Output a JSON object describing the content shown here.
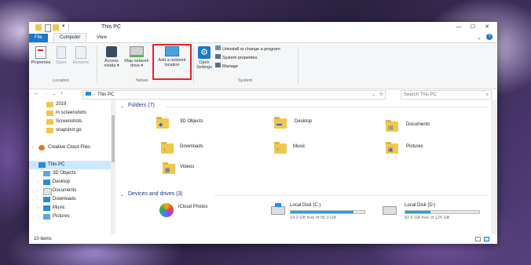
{
  "window": {
    "title": "This PC"
  },
  "ribbon": {
    "tabs": [
      "File",
      "Computer",
      "View"
    ],
    "location_group": {
      "label": "Location",
      "buttons": [
        {
          "label": "Properties"
        },
        {
          "label": "Open"
        },
        {
          "label": "Rename"
        }
      ]
    },
    "network_group": {
      "label": "Netwo",
      "buttons": [
        {
          "label1": "Access",
          "label2": "media ▾"
        },
        {
          "label1": "Map network",
          "label2": "drive ▾"
        },
        {
          "label1": "Add a network",
          "label2": "location"
        }
      ]
    },
    "system_group": {
      "label": "System",
      "open_settings": {
        "label1": "Open",
        "label2": "Settings"
      },
      "links": [
        "Uninstall or change a program",
        "System properties",
        "Manage"
      ]
    }
  },
  "addressbar": {
    "path": "This PC",
    "search_placeholder": "Search This PC"
  },
  "nav": {
    "items": [
      "2019",
      "m screenshots",
      "Screenshots",
      "snapshot go",
      "Creative Cloud Files",
      "This PC",
      "3D Objects",
      "Desktop",
      "Documents",
      "Downloads",
      "Music",
      "Pictures"
    ]
  },
  "content": {
    "folders_header": "Folders (7)",
    "folders": [
      "3D Objects",
      "Desktop",
      "Documents",
      "Downloads",
      "Music",
      "Pictures",
      "Videos"
    ],
    "devices_header": "Devices and drives (3)",
    "devices": [
      {
        "name": "iCloud Photos"
      },
      {
        "name": "Local Disk (C:)",
        "free": "14.2 GB free of 96.3 GB",
        "used_fraction": 0.85
      },
      {
        "name": "Local Disk (D:)",
        "free": "82.6 GB free of 125 GB",
        "used_fraction": 0.34
      }
    ]
  },
  "status": {
    "items": "10 items"
  }
}
